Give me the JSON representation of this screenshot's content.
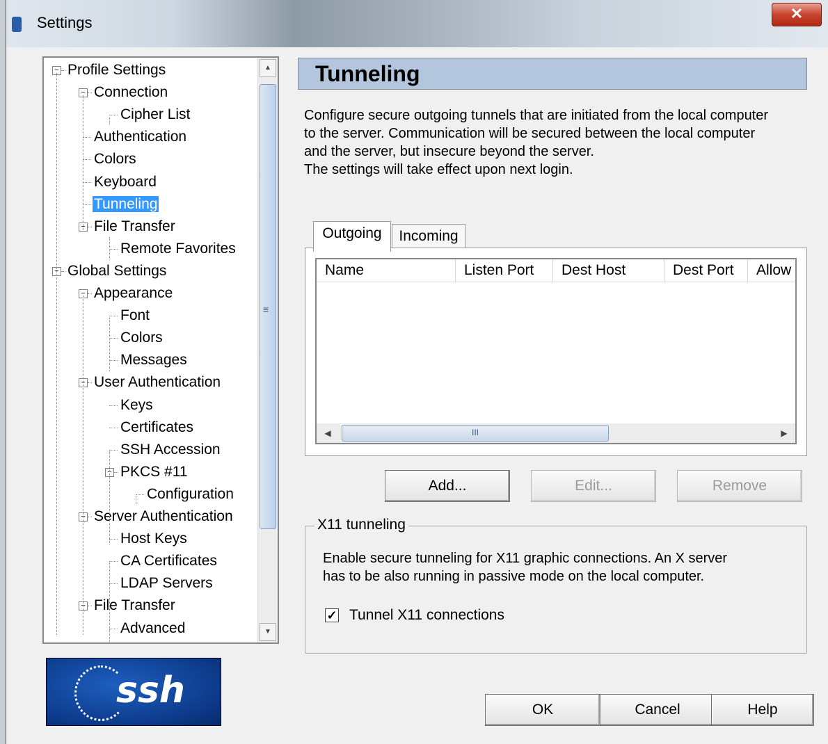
{
  "window": {
    "title": "Settings"
  },
  "tree": {
    "items": [
      {
        "label": "Profile Settings",
        "level": 0,
        "expander": "−"
      },
      {
        "label": "Connection",
        "level": 1,
        "expander": "−"
      },
      {
        "label": "Cipher List",
        "level": 2
      },
      {
        "label": "Authentication",
        "level": 1
      },
      {
        "label": "Colors",
        "level": 1
      },
      {
        "label": "Keyboard",
        "level": 1
      },
      {
        "label": "Tunneling",
        "level": 1,
        "selected": true
      },
      {
        "label": "File Transfer",
        "level": 1,
        "expander": "−"
      },
      {
        "label": "Remote Favorites",
        "level": 2
      },
      {
        "label": "Global Settings",
        "level": 0,
        "expander": "−"
      },
      {
        "label": "Appearance",
        "level": 1,
        "expander": "−"
      },
      {
        "label": "Font",
        "level": 2
      },
      {
        "label": "Colors",
        "level": 2
      },
      {
        "label": "Messages",
        "level": 2
      },
      {
        "label": "User Authentication",
        "level": 1,
        "expander": "−"
      },
      {
        "label": "Keys",
        "level": 2
      },
      {
        "label": "Certificates",
        "level": 2
      },
      {
        "label": "SSH Accession",
        "level": 2
      },
      {
        "label": "PKCS #11",
        "level": 2,
        "expander": "−"
      },
      {
        "label": "Configuration",
        "level": 3
      },
      {
        "label": "Server Authentication",
        "level": 1,
        "expander": "−"
      },
      {
        "label": "Host Keys",
        "level": 2
      },
      {
        "label": "CA Certificates",
        "level": 2
      },
      {
        "label": "LDAP Servers",
        "level": 2
      },
      {
        "label": "File Transfer",
        "level": 1,
        "expander": "−"
      },
      {
        "label": "Advanced",
        "level": 2
      }
    ],
    "scroll_grip": "≡"
  },
  "logo": {
    "text": "ssh"
  },
  "panel": {
    "title": "Tunneling",
    "description": [
      "Configure secure outgoing tunnels that are initiated from the local computer",
      "to the server. Communication will be secured between the local computer",
      "and the server, but insecure beyond the server.",
      "The settings will take effect upon next login."
    ]
  },
  "tabs": [
    {
      "label": "Outgoing",
      "active": true
    },
    {
      "label": "Incoming",
      "active": false
    }
  ],
  "table": {
    "columns": [
      "Name",
      "Listen Port",
      "Dest Host",
      "Dest Port",
      "Allow"
    ],
    "rows": [],
    "hscroll_grip": "III"
  },
  "actions": {
    "add": "Add...",
    "edit": "Edit...",
    "remove": "Remove"
  },
  "x11": {
    "title": "X11 tunneling",
    "description": [
      "Enable secure tunneling for X11 graphic connections. An X server",
      "has to be also running in passive mode on the local computer."
    ],
    "checkbox_label": "Tunnel X11 connections",
    "checked": true
  },
  "dialog": {
    "ok": "OK",
    "cancel": "Cancel",
    "help": "Help"
  },
  "icons": {
    "close": "close-icon",
    "collapse": "minus-box-icon",
    "scroll_up": "arrow-up-icon",
    "scroll_down": "arrow-down-icon",
    "scroll_left": "arrow-left-icon",
    "scroll_right": "arrow-right-icon",
    "check": "checkmark-icon"
  },
  "colors": {
    "selection": "#3399ff",
    "header_bg": "#b4c6de",
    "logo_bg": "#0d3a8a"
  }
}
